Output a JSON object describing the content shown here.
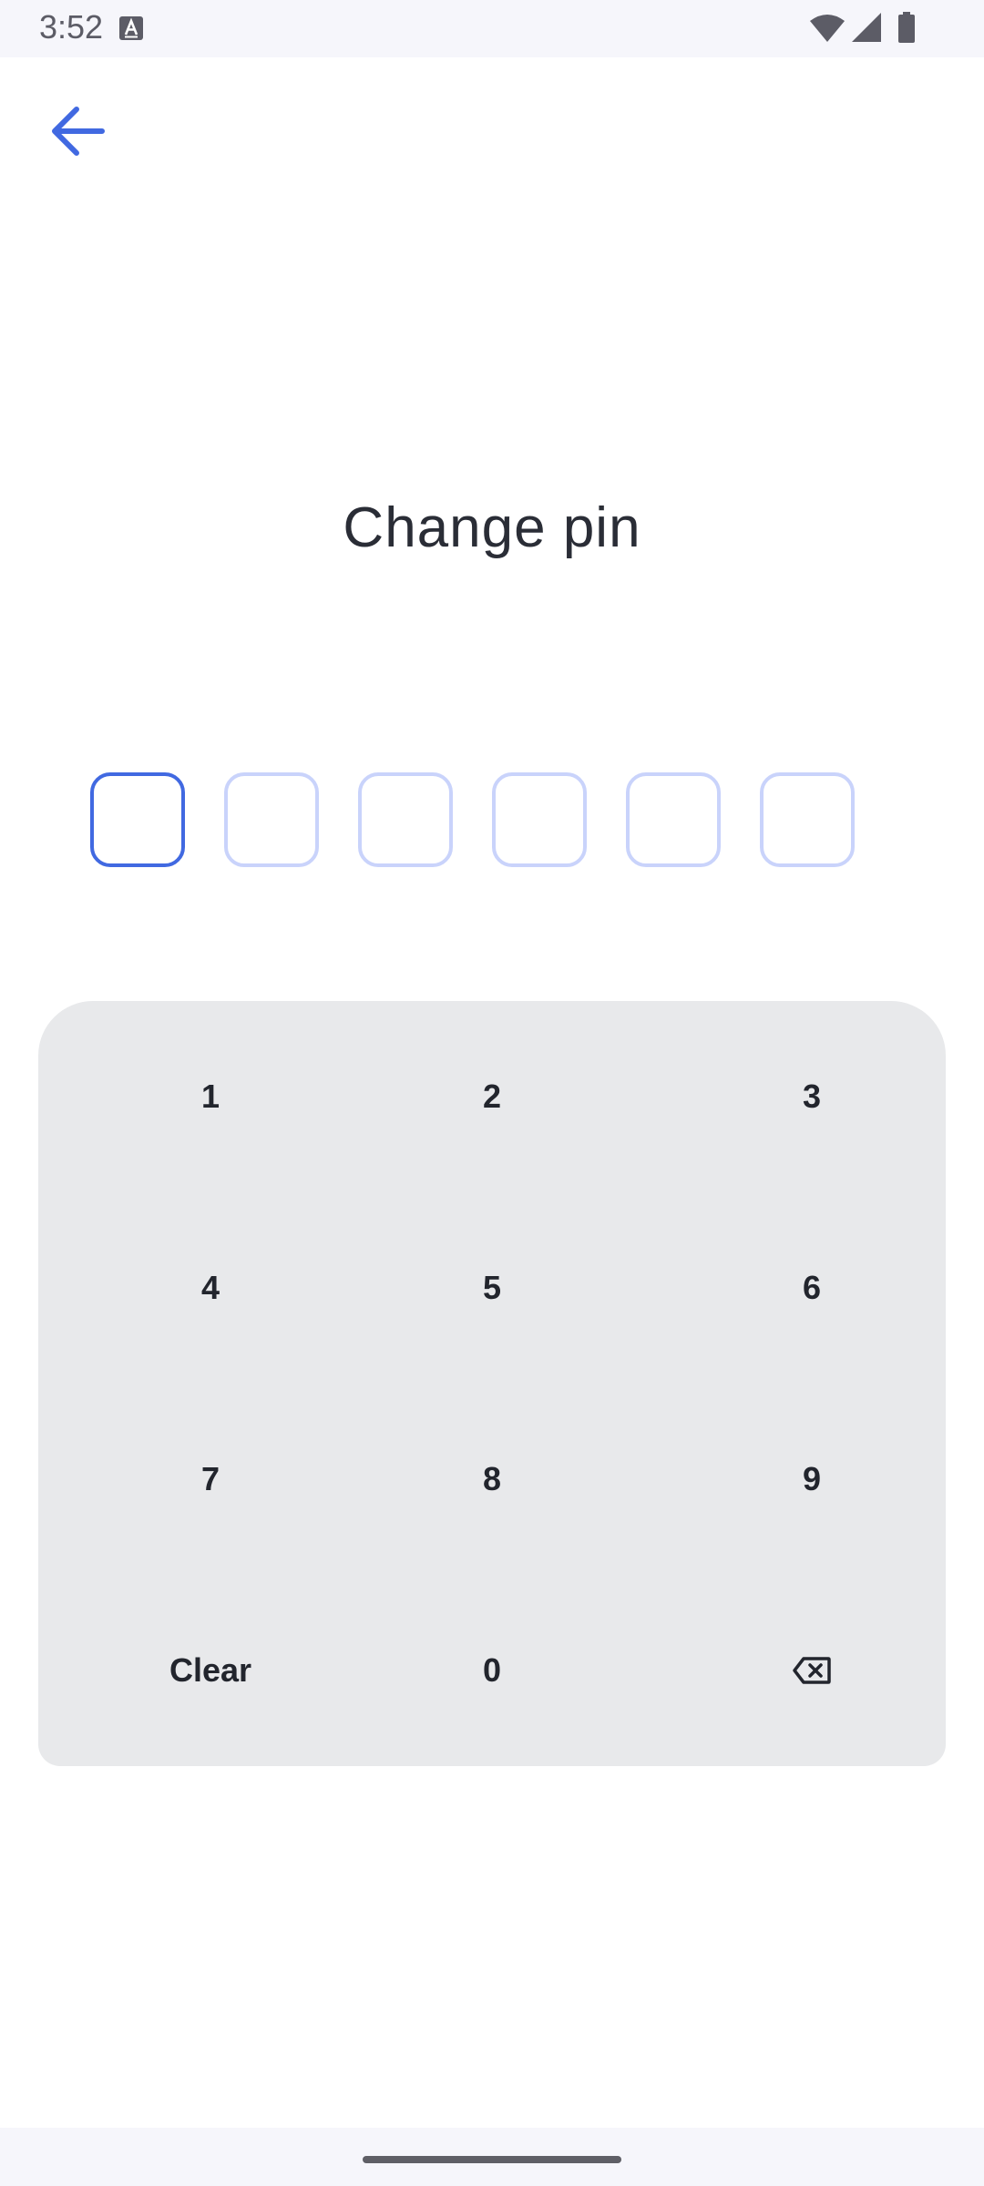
{
  "status_bar": {
    "time": "3:52",
    "icons": [
      "keyboard-a-icon",
      "wifi-icon",
      "cellular-signal-icon",
      "battery-icon"
    ]
  },
  "header": {
    "back_icon": "arrow-left-icon"
  },
  "title": "Change pin",
  "pin": {
    "length": 6,
    "filled": 0,
    "active_index": 0
  },
  "keypad": {
    "keys": [
      {
        "label": "1"
      },
      {
        "label": "2"
      },
      {
        "label": "3"
      },
      {
        "label": "4"
      },
      {
        "label": "5"
      },
      {
        "label": "6"
      },
      {
        "label": "7"
      },
      {
        "label": "8"
      },
      {
        "label": "9"
      },
      {
        "label": "Clear"
      },
      {
        "label": "0"
      },
      {
        "label": "⌫"
      }
    ]
  },
  "colors": {
    "accent": "#4169E1",
    "pin_inactive_border": "#C9D3FB",
    "keypad_background": "#E8E9EB",
    "text": "#22252D"
  }
}
